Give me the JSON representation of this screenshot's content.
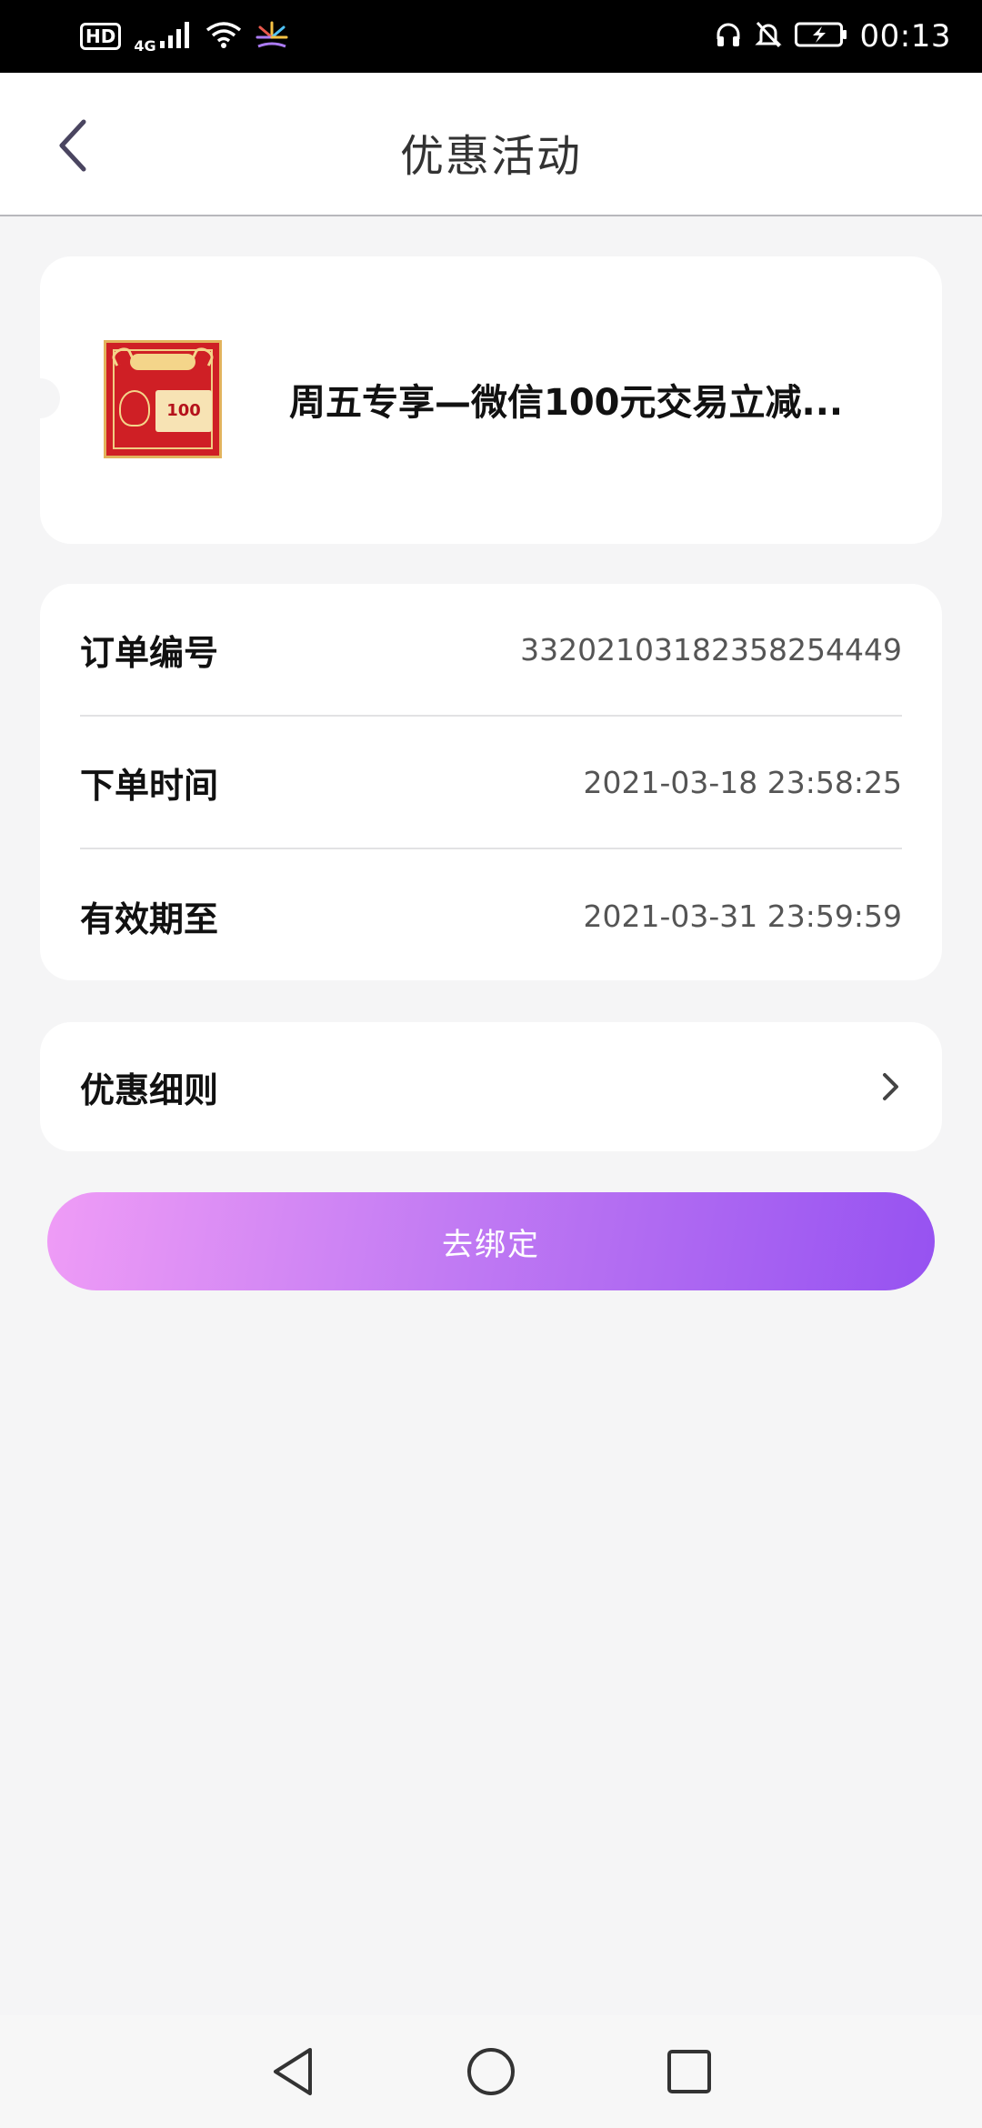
{
  "status_bar": {
    "hd": "HD",
    "network": "4G",
    "time": "00:13"
  },
  "header": {
    "title": "优惠活动"
  },
  "coupon": {
    "title": "周五专享—微信100元交易立减...",
    "image_badge": "100"
  },
  "order_info": {
    "rows": [
      {
        "label": "订单编号",
        "value": "33202103182358254449"
      },
      {
        "label": "下单时间",
        "value": "2021-03-18 23:58:25"
      },
      {
        "label": "有效期至",
        "value": "2021-03-31 23:59:59"
      }
    ]
  },
  "rules": {
    "label": "优惠细则"
  },
  "actions": {
    "bind_label": "去绑定"
  },
  "colors": {
    "accent_start": "#ef9cf6",
    "accent_end": "#9652f1",
    "background": "#f5f5f6"
  }
}
